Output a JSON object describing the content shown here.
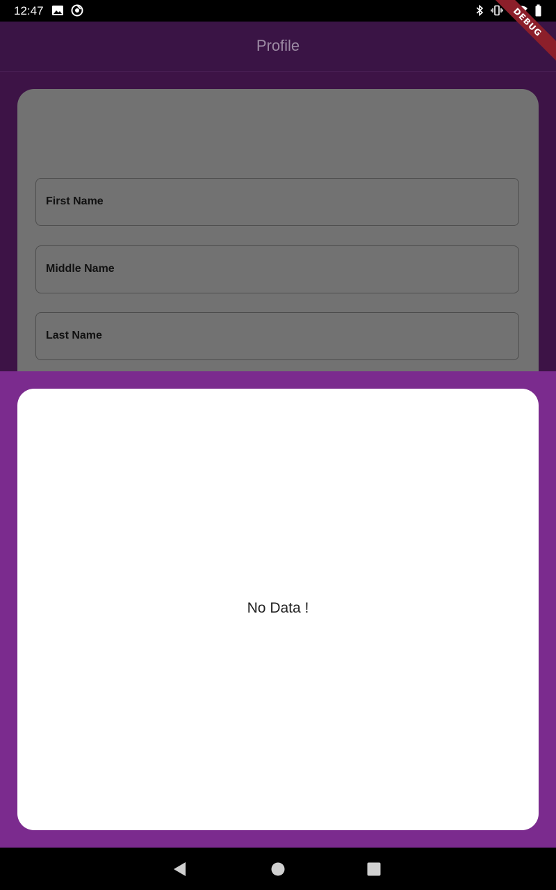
{
  "status_bar": {
    "time": "12:47",
    "left_icons": [
      "image-icon",
      "sync-icon"
    ],
    "right_icons": [
      "bluetooth-icon",
      "vibrate-icon",
      "wifi-icon",
      "battery-icon"
    ]
  },
  "debug_banner": {
    "label": "DEBUG"
  },
  "app_bar": {
    "title": "Profile"
  },
  "profile_form": {
    "fields": [
      {
        "label": "First Name"
      },
      {
        "label": "Middle Name"
      },
      {
        "label": "Last Name"
      }
    ]
  },
  "bottom_sheet": {
    "empty_message": "No Data !"
  },
  "nav_bar": {
    "buttons": [
      "back-icon",
      "home-icon",
      "recents-icon"
    ]
  },
  "colors": {
    "app_bar": "#3a1445",
    "sheet": "#7b2b8e",
    "card": "#ffffff",
    "dimmed_card": "#727272"
  }
}
